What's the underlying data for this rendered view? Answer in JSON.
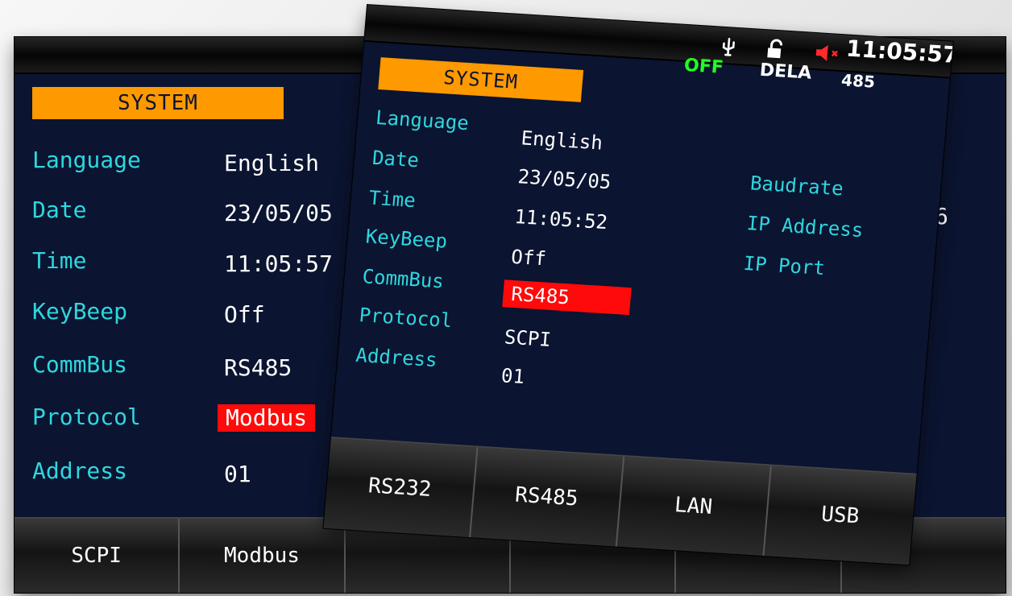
{
  "back_screen": {
    "section_title": "SYSTEM",
    "fields": [
      {
        "label": "Language",
        "value": "English"
      },
      {
        "label": "Date",
        "value": "23/05/05"
      },
      {
        "label": "Time",
        "value": "11:05:57"
      },
      {
        "label": "KeyBeep",
        "value": "Off"
      },
      {
        "label": "CommBus",
        "value": "RS485"
      },
      {
        "label": "Protocol",
        "value": "Modbus"
      },
      {
        "label": "Address",
        "value": "01"
      }
    ],
    "softkeys": [
      "SCPI",
      "Modbus",
      "",
      "",
      "",
      ""
    ],
    "colors": {
      "screen_bg": "#0b1430",
      "label": "#2ed7df",
      "value": "#ffffff",
      "highlight": "#ff0a0a",
      "section_title_bg": "#ff9900"
    }
  },
  "front_screen": {
    "status": {
      "off": "OFF",
      "mode": "DELA",
      "interface": "485",
      "time": "11:05:57"
    },
    "section_title": "SYSTEM",
    "fields": [
      {
        "label": "Language",
        "value": "English"
      },
      {
        "label": "Date",
        "value": "23/05/05"
      },
      {
        "label": "Time",
        "value": "11:05:52"
      },
      {
        "label": "KeyBeep",
        "value": "Off"
      },
      {
        "label": "CommBus",
        "value": "RS485"
      },
      {
        "label": "Protocol",
        "value": "SCPI"
      },
      {
        "label": "Address",
        "value": "01"
      }
    ],
    "right_labels": [
      "Baudrate",
      "IP Address",
      "IP Port"
    ],
    "right_value_fragment": "6",
    "softkeys": [
      "RS232",
      "RS485",
      "LAN",
      "USB"
    ],
    "icons": [
      "usb-icon",
      "unlock-icon",
      "speaker-muted-icon"
    ]
  }
}
